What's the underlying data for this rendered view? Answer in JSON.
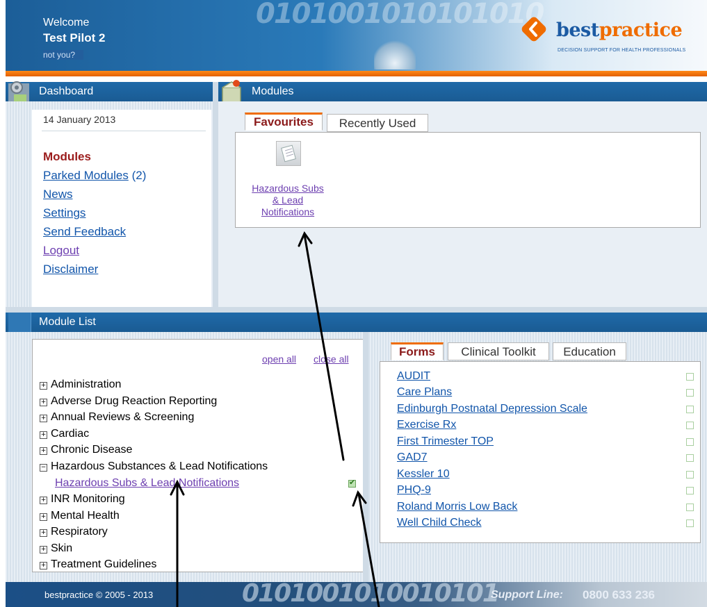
{
  "header": {
    "welcome": "Welcome",
    "user_name": "Test Pilot 2",
    "not_you": "not you?",
    "binary_text": "0101001010101010",
    "logo": {
      "best": "best",
      "practice": "practice",
      "tagline": "DECISION SUPPORT FOR HEALTH PROFESSIONALS"
    }
  },
  "dashboard": {
    "title": "Dashboard",
    "date": "14 January 2013",
    "nav": {
      "modules": "Modules",
      "parked": "Parked Modules",
      "parked_count": "(2)",
      "news": "News",
      "settings": "Settings",
      "feedback": "Send Feedback",
      "logout": "Logout",
      "disclaimer": "Disclaimer"
    }
  },
  "modules": {
    "title": "Modules",
    "tabs": {
      "favourites": "Favourites",
      "recent": "Recently Used"
    },
    "favourite_item": "Hazardous Subs & Lead Notifications"
  },
  "module_list": {
    "title": "Module List",
    "open_all": "open all",
    "close_all": "close all",
    "items": {
      "i0": "Administration",
      "i1": "Adverse Drug Reaction Reporting",
      "i2": "Annual Reviews & Screening",
      "i3": "Cardiac",
      "i4": "Chronic Disease",
      "i5": "Hazardous Substances & Lead Notifications",
      "i6": "INR Monitoring",
      "i7": "Mental Health",
      "i8": "Respiratory",
      "i9": "Skin",
      "i10": "Treatment Guidelines"
    },
    "sub_item": "Hazardous Subs & Lead Notifications",
    "expand_glyph": "⊞",
    "collapse_glyph": "⊟"
  },
  "forms": {
    "tabs": {
      "forms": "Forms",
      "toolkit": "Clinical Toolkit",
      "education": "Education"
    },
    "items": {
      "f0": "AUDIT",
      "f1": "Care Plans",
      "f2": "Edinburgh Postnatal Depression Scale",
      "f3": "Exercise Rx",
      "f4": "First Trimester TOP",
      "f5": "GAD7",
      "f6": "Kessler 10",
      "f7": "PHQ-9",
      "f8": "Roland Morris Low Back",
      "f9": "Well Child Check"
    }
  },
  "footer": {
    "copyright": "bestpractice © 2005 - 2013",
    "binary_text": "0101001010010101",
    "support_label": "Support Line:",
    "support_number": "0800 633 236"
  },
  "colors": {
    "brand_blue": "#1b5aa3",
    "accent_orange": "#ef6c00",
    "link": "#1155aa"
  }
}
